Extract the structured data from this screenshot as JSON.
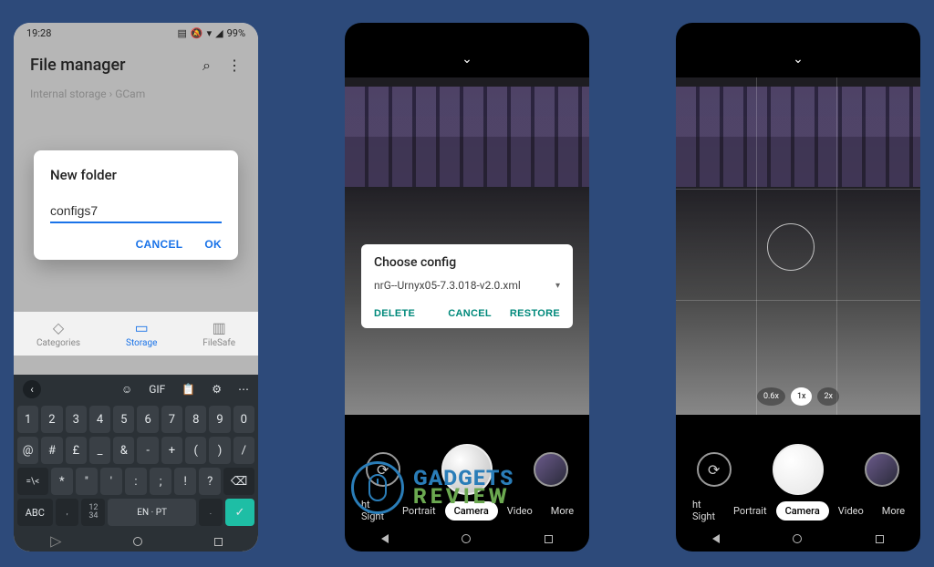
{
  "screenshot1": {
    "status": {
      "time": "19:28",
      "battery": "99%"
    },
    "appTitle": "File manager",
    "breadcrumb": {
      "parent": "Internal storage",
      "sep": "›",
      "current": "GCam"
    },
    "bottomTabs": {
      "categories": "Categories",
      "storage": "Storage",
      "filesafe": "FileSafe"
    },
    "dialog": {
      "title": "New folder",
      "inputValue": "configs7",
      "cancel": "CANCEL",
      "ok": "OK"
    },
    "keyboard": {
      "toolbar": {
        "gif": "GIF"
      },
      "row1": [
        "1",
        "2",
        "3",
        "4",
        "5",
        "6",
        "7",
        "8",
        "9",
        "0"
      ],
      "row2": [
        "@",
        "#",
        "£",
        "_",
        "&",
        "-",
        "+",
        "(",
        ")",
        "/"
      ],
      "row3_lead": "=\\<",
      "row3": [
        "*",
        "\"",
        "'",
        ":",
        ";",
        "!",
        "?"
      ],
      "row3_back": "⌫",
      "row4": {
        "abc": "ABC",
        "comma": ",",
        "lang": "EN · PT",
        "dot": ".",
        "enter": "✓",
        "sub": "12\n34"
      }
    }
  },
  "screenshot2": {
    "dialog": {
      "title": "Choose config",
      "selected": "nrG--Urnyx05-7.3.018-v2.0.xml",
      "delete": "DELETE",
      "cancel": "CANCEL",
      "restore": "RESTORE"
    },
    "modes": {
      "nightsight": "ht Sight",
      "portrait": "Portrait",
      "camera": "Camera",
      "video": "Video",
      "more": "More"
    }
  },
  "screenshot3": {
    "zoom": {
      "wide": "0.6x",
      "normal": "1x",
      "tele": "2x"
    },
    "modes": {
      "nightsight": "ht Sight",
      "portrait": "Portrait",
      "camera": "Camera",
      "video": "Video",
      "more": "More"
    }
  },
  "watermark": {
    "line1": "GADGETS",
    "line2": "REVIEW"
  }
}
